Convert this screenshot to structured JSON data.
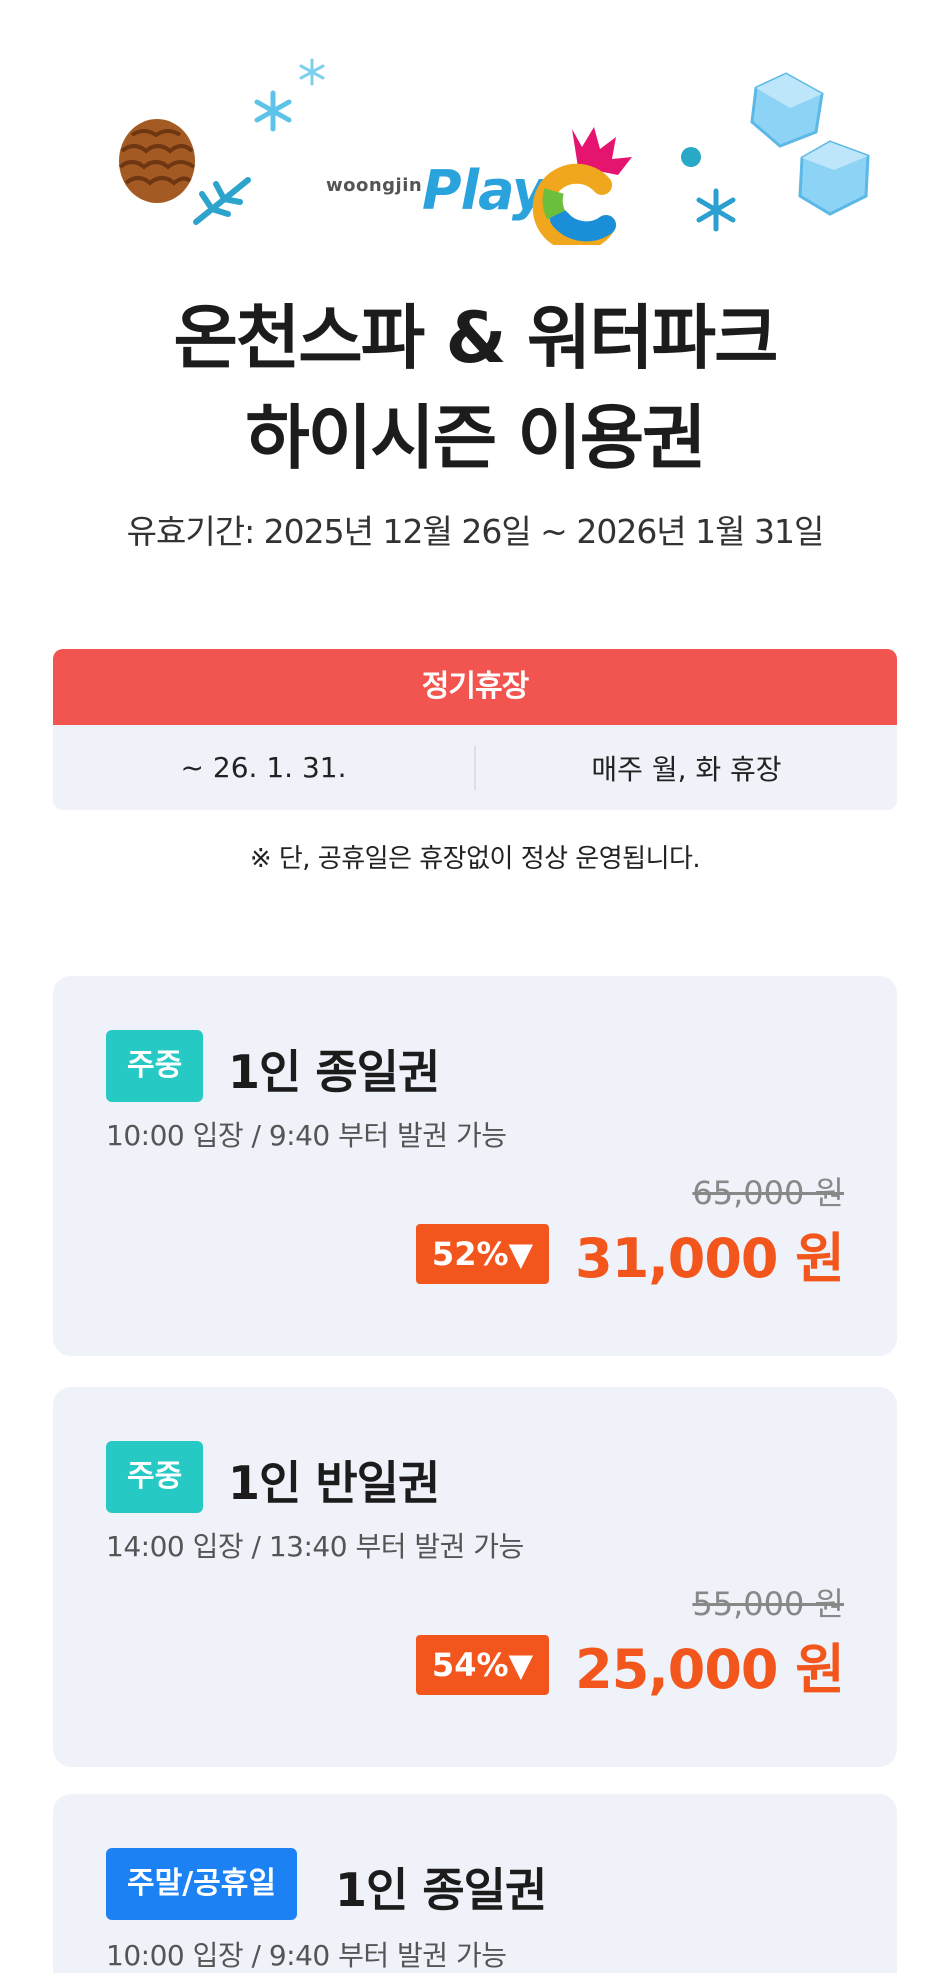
{
  "header": {
    "brand": "woongjin",
    "logo_text": "Play"
  },
  "title": {
    "line1": "온천스파 & 워터파크",
    "line2": "하이시즌 이용권"
  },
  "validity": "유효기간: 2025년 12월 26일 ~ 2026년 1월 31일",
  "closure": {
    "heading": "정기휴장",
    "period": "~ 26. 1. 31.",
    "days": "매주 월, 화 휴장"
  },
  "notice": "※ 단, 공휴일은 휴장없이 정상 운영됩니다.",
  "tickets": [
    {
      "badge": "주중",
      "name": "1인 종일권",
      "time": "10:00 입장 / 9:40 부터 발권 가능",
      "original_price": "65,000 원",
      "discount": "52%▼",
      "price": "31,000 원"
    },
    {
      "badge": "주중",
      "name": "1인 반일권",
      "time": "14:00 입장 / 13:40 부터 발권 가능",
      "original_price": "55,000 원",
      "discount": "54%▼",
      "price": "25,000 원"
    },
    {
      "badge": "주말/공휴일",
      "name": "1인 종일권",
      "time": "10:00 입장 / 9:40 부터 발권 가능"
    }
  ],
  "colors": {
    "closure_header": "#f2554f",
    "weekday_badge": "#27c9c4",
    "weekend_badge": "#1c82f4",
    "sale": "#f2561c",
    "card_bg": "#f0f2f9"
  }
}
